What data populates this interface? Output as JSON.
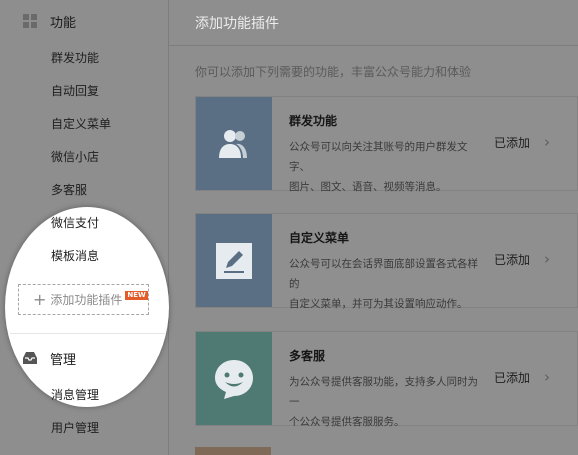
{
  "sidebar": {
    "function_section": {
      "title": "功能",
      "icon": "grid-icon"
    },
    "items": [
      {
        "label": "群发功能"
      },
      {
        "label": "自动回复"
      },
      {
        "label": "自定义菜单"
      },
      {
        "label": "微信小店"
      },
      {
        "label": "多客服"
      },
      {
        "label": "微信支付"
      },
      {
        "label": "模板消息"
      }
    ],
    "add_plugin": {
      "label": "添加功能插件",
      "badge": "NEW",
      "icon": "plus-icon"
    },
    "manage_section": {
      "title": "管理",
      "icon": "inbox-icon"
    },
    "manage_items": [
      {
        "label": "消息管理"
      },
      {
        "label": "用户管理"
      }
    ]
  },
  "main": {
    "title": "添加功能插件",
    "intro": "你可以添加下列需要的功能，丰富公众号能力和体验",
    "plugins": [
      {
        "name": "群发功能",
        "desc_line1": "公众号可以向关注其账号的用户群发文字、",
        "desc_line2": "图片、图文、语音、视频等消息。",
        "status": "已添加",
        "icon": "users-icon",
        "color": "#5a6f83"
      },
      {
        "name": "自定义菜单",
        "desc_line1": "公众号可以在会话界面底部设置各式各样的",
        "desc_line2": "自定义菜单，并可为其设置响应动作。",
        "status": "已添加",
        "icon": "edit-icon",
        "color": "#5a6f83"
      },
      {
        "name": "多客服",
        "desc_line1": "为公众号提供客服功能，支持多人同时为一",
        "desc_line2": "个公众号提供客服服务。",
        "status": "已添加",
        "icon": "smile-chat-icon",
        "color": "#4e7a73"
      }
    ]
  },
  "colors": {
    "overlay": "#8e8e8e",
    "badge": "#e45c2a"
  }
}
